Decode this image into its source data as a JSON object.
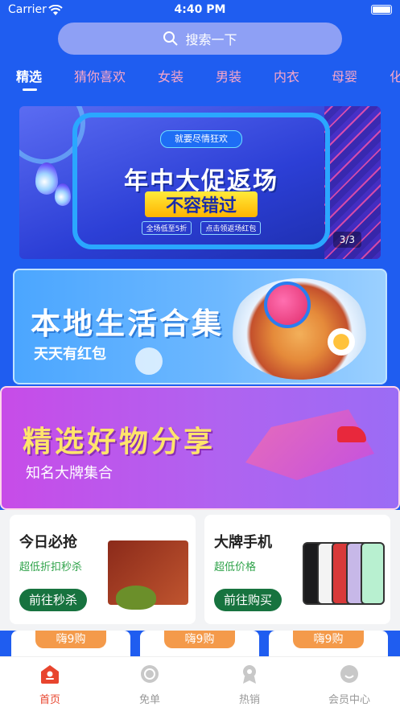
{
  "status_bar": {
    "carrier": "Carrier",
    "time": "4:40 PM"
  },
  "search": {
    "placeholder": "搜索一下"
  },
  "tabs": [
    {
      "label": "精选"
    },
    {
      "label": "猜你喜欢"
    },
    {
      "label": "女装"
    },
    {
      "label": "男装"
    },
    {
      "label": "内衣"
    },
    {
      "label": "母婴"
    },
    {
      "label": "化"
    }
  ],
  "banner": {
    "pill": "就要尽情狂欢",
    "title": "年中大促返场",
    "subtitle": "不容错过",
    "chips": [
      "全场低至5折",
      "点击领返场红包"
    ],
    "page_indicator": "3/3"
  },
  "local_card": {
    "title": "本地生活合集",
    "subtitle": "天天有红包"
  },
  "share_card": {
    "title": "精选好物分享",
    "subtitle": "知名大牌集合"
  },
  "deals": [
    {
      "title": "今日必抢",
      "subtitle": "超低折扣秒杀",
      "button": "前往秒杀"
    },
    {
      "title": "大牌手机",
      "subtitle": "超低价格",
      "button": "前往购买"
    }
  ],
  "strip_badges": [
    "嗨9购",
    "嗨9购",
    "嗨9购"
  ],
  "tabbar": [
    {
      "label": "首页",
      "icon": "home-icon",
      "active": true
    },
    {
      "label": "免单",
      "icon": "free-order-icon",
      "active": false
    },
    {
      "label": "热销",
      "icon": "hot-sale-icon",
      "active": false
    },
    {
      "label": "会员中心",
      "icon": "member-center-icon",
      "active": false
    }
  ],
  "colors": {
    "background": "#1f5df0",
    "accent": "#e8452e",
    "deal_button": "#17733f",
    "badge": "#f49a4a"
  }
}
